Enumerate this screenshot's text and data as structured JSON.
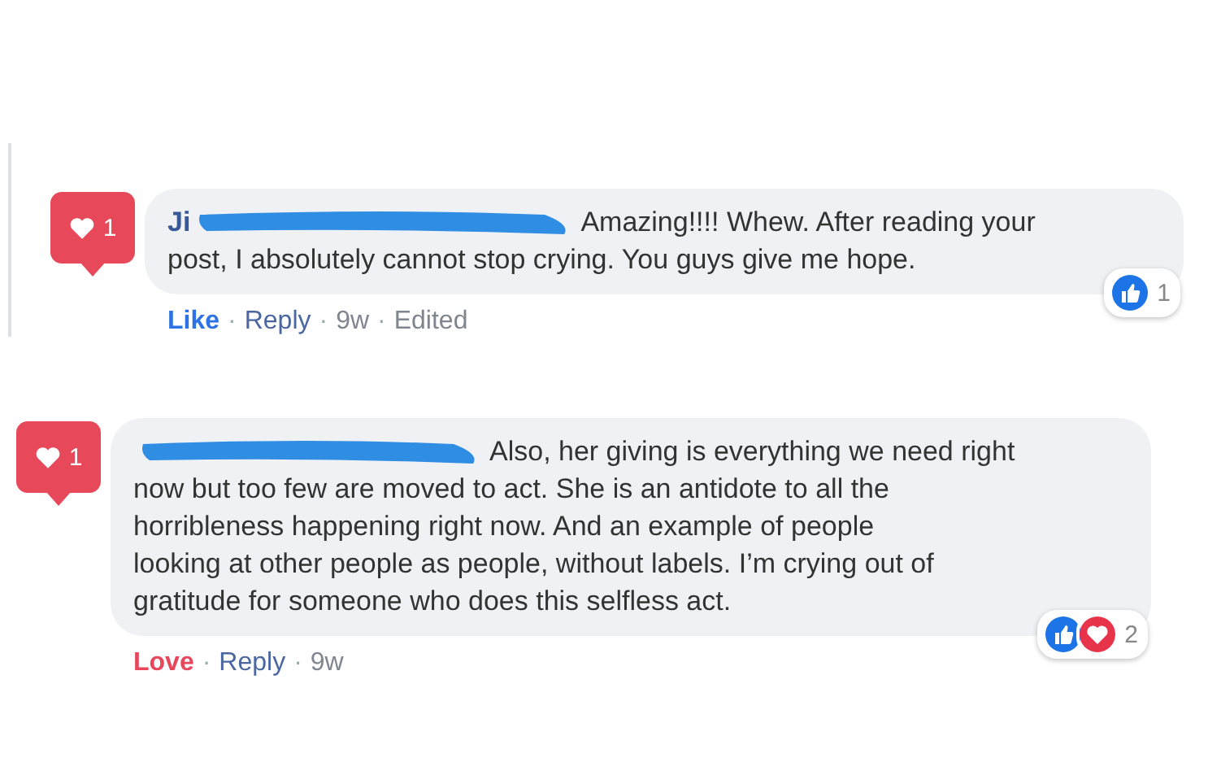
{
  "comments": [
    {
      "author": "Ji",
      "lines": [
        "Amazing!!!! Whew. After reading your",
        "post, I absolutely cannot stop crying. You guys give me hope."
      ],
      "badge": {
        "count": "1"
      },
      "reaction": {
        "kind": "like",
        "label": "Like"
      },
      "separator": "·",
      "meta": [
        "Reply",
        "9w",
        "Edited"
      ],
      "reactions": {
        "icons": [
          {
            "kind": "like"
          }
        ],
        "count": "1"
      }
    },
    {
      "lines": [
        "Also, her giving is everything we need right",
        "now but too few are moved to act. She is an antidote to all the",
        "horribleness happening right now. And an example of people",
        "looking at other people as people, without labels. I’m crying out of",
        "gratitude for someone who does this selfless act."
      ],
      "badge": {
        "count": "1"
      },
      "reaction": {
        "kind": "love",
        "label": "Love"
      },
      "separator": "·",
      "meta": [
        "Reply",
        "9w"
      ],
      "reactions": {
        "icons": [
          {
            "kind": "like"
          },
          {
            "kind": "love"
          }
        ],
        "count": "2"
      }
    }
  ]
}
